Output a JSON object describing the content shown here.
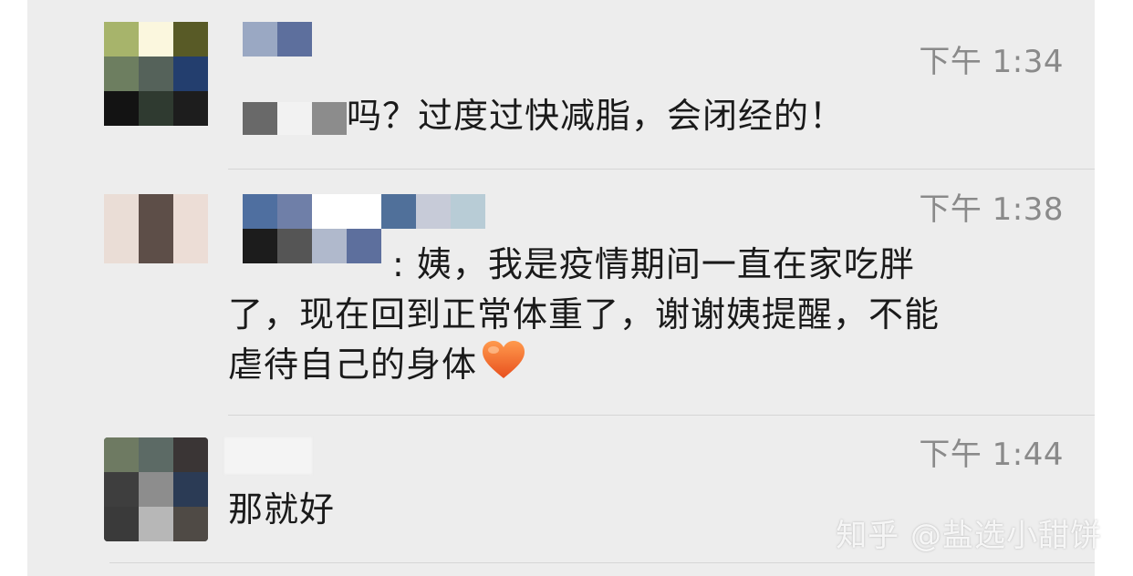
{
  "messages": [
    {
      "time": "下午 1:34",
      "lines": [
        "吗？过度过快减脂，会闭经的！"
      ]
    },
    {
      "time": "下午 1:38",
      "lines": [
        ": 姨，我是疫情期间一直在家吃胖",
        "了，现在回到正常体重了，谢谢姨提醒，不能",
        "虐待自己的身体"
      ],
      "emoji": "orange-heart"
    },
    {
      "time": "下午 1:44",
      "lines": [
        "那就好"
      ]
    }
  ],
  "watermark": "知乎 @盐选小甜饼",
  "colors": {
    "background": "#ededed",
    "text": "#1a1a1a",
    "time": "#8a8a8a",
    "heart": "#f0642a"
  }
}
